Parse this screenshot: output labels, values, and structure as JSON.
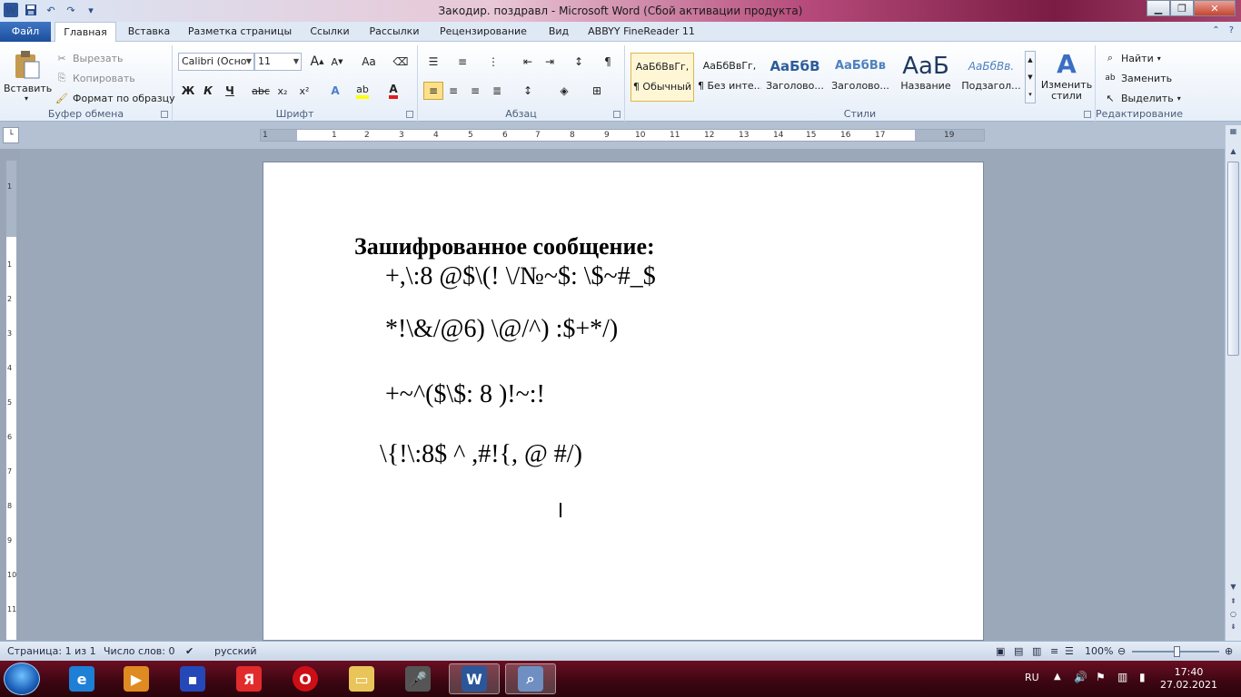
{
  "window": {
    "title": "Закодир. поздравл  -  Microsoft Word (Сбой активации продукта)"
  },
  "tabs": [
    {
      "label": "Файл"
    },
    {
      "label": "Главная"
    },
    {
      "label": "Вставка"
    },
    {
      "label": "Разметка страницы"
    },
    {
      "label": "Ссылки"
    },
    {
      "label": "Рассылки"
    },
    {
      "label": "Рецензирование"
    },
    {
      "label": "Вид"
    },
    {
      "label": "ABBYY FineReader 11"
    }
  ],
  "clipboard": {
    "paste": "Вставить",
    "cut": "Вырезать",
    "copy": "Копировать",
    "format_painter": "Формат по образцу",
    "label": "Буфер обмена"
  },
  "font": {
    "name": "Calibri (Осно",
    "size": "11",
    "label": "Шрифт",
    "bold": "Ж",
    "italic": "К",
    "underline": "Ч",
    "grow": "A",
    "shrink": "A",
    "case": "Аа"
  },
  "paragraph": {
    "label": "Абзац"
  },
  "styles": {
    "label": "Стили",
    "items": [
      {
        "sample": "АаБбВвГг,",
        "name": "¶ Обычный"
      },
      {
        "sample": "АаБбВвГг,",
        "name": "¶ Без инте..."
      },
      {
        "sample": "АаБбВ",
        "name": "Заголово..."
      },
      {
        "sample": "АаБбВв",
        "name": "Заголово..."
      },
      {
        "sample": "АаБ",
        "name": "Название"
      },
      {
        "sample": "АаБбВв.",
        "name": "Подзагол..."
      }
    ],
    "change_styles": "Изменить стили"
  },
  "editing": {
    "label": "Редактирование",
    "find": "Найти",
    "replace": "Заменить",
    "select": "Выделить"
  },
  "ruler": {
    "numbers": [
      "1",
      "1",
      "2",
      "3",
      "4",
      "5",
      "6",
      "7",
      "8",
      "9",
      "10",
      "11",
      "12",
      "13",
      "14",
      "15",
      "16",
      "17",
      "19"
    ]
  },
  "vruler": {
    "numbers": [
      "1",
      "1",
      "2",
      "3",
      "4",
      "5",
      "6",
      "7",
      "8",
      "9",
      "10",
      "11"
    ]
  },
  "document": {
    "title": "Зашифрованное сообщение:",
    "lines": [
      "+,\\:8 @$\\(! \\/№~$: \\$~#_$",
      "*!\\&/@6) \\@/^) :$+*/)",
      "+~^($\\$: 8 )!~:!",
      "\\{!\\:8$ ^ ,#!{, @ #/)"
    ]
  },
  "status": {
    "page": "Страница: 1 из 1",
    "words": "Число слов: 0",
    "language": "русский",
    "zoom": "100%"
  },
  "taskbar": {
    "lang": "RU",
    "time": "17:40",
    "date": "27.02.2021"
  },
  "colors": {
    "accent": "#2b579a",
    "file_tab": "#1c4f9c",
    "taskbar": "#3b0612"
  }
}
